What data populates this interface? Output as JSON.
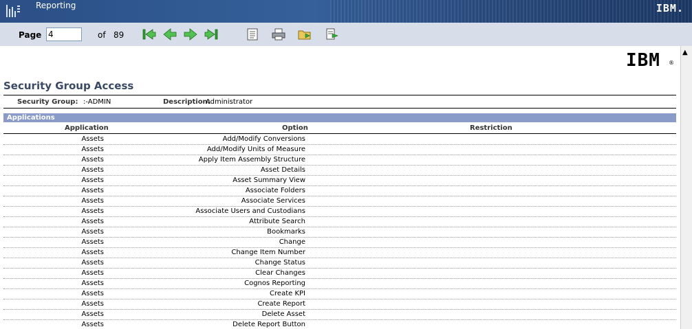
{
  "header": {
    "app_title": "Reporting",
    "brand": "IBM."
  },
  "toolbar": {
    "page_label": "Page",
    "page_value": "4",
    "of_label": "of",
    "total_pages": "89"
  },
  "report": {
    "logo": "IBM",
    "logo_reg": "®",
    "title": "Security Group Access",
    "security_group_label": "Security Group:",
    "security_group_value": ":-ADMIN",
    "description_label": "Description:",
    "description_value": "Administrator",
    "section_label": "Applications",
    "columns": {
      "application": "Application",
      "option": "Option",
      "restriction": "Restriction"
    },
    "rows": [
      {
        "application": "Assets",
        "option": "Add/Modify Conversions",
        "restriction": ""
      },
      {
        "application": "Assets",
        "option": "Add/Modify Units of Measure",
        "restriction": ""
      },
      {
        "application": "Assets",
        "option": "Apply Item Assembly Structure",
        "restriction": ""
      },
      {
        "application": "Assets",
        "option": "Asset Details",
        "restriction": ""
      },
      {
        "application": "Assets",
        "option": "Asset Summary View",
        "restriction": ""
      },
      {
        "application": "Assets",
        "option": "Associate Folders",
        "restriction": ""
      },
      {
        "application": "Assets",
        "option": "Associate Services",
        "restriction": ""
      },
      {
        "application": "Assets",
        "option": "Associate Users and Custodians",
        "restriction": ""
      },
      {
        "application": "Assets",
        "option": "Attribute Search",
        "restriction": ""
      },
      {
        "application": "Assets",
        "option": "Bookmarks",
        "restriction": ""
      },
      {
        "application": "Assets",
        "option": "Change",
        "restriction": ""
      },
      {
        "application": "Assets",
        "option": "Change Item Number",
        "restriction": ""
      },
      {
        "application": "Assets",
        "option": "Change Status",
        "restriction": ""
      },
      {
        "application": "Assets",
        "option": "Clear Changes",
        "restriction": ""
      },
      {
        "application": "Assets",
        "option": "Cognos Reporting",
        "restriction": ""
      },
      {
        "application": "Assets",
        "option": "Create KPI",
        "restriction": ""
      },
      {
        "application": "Assets",
        "option": "Create Report",
        "restriction": ""
      },
      {
        "application": "Assets",
        "option": "Delete Asset",
        "restriction": ""
      },
      {
        "application": "Assets",
        "option": "Delete Report Button",
        "restriction": ""
      }
    ]
  }
}
